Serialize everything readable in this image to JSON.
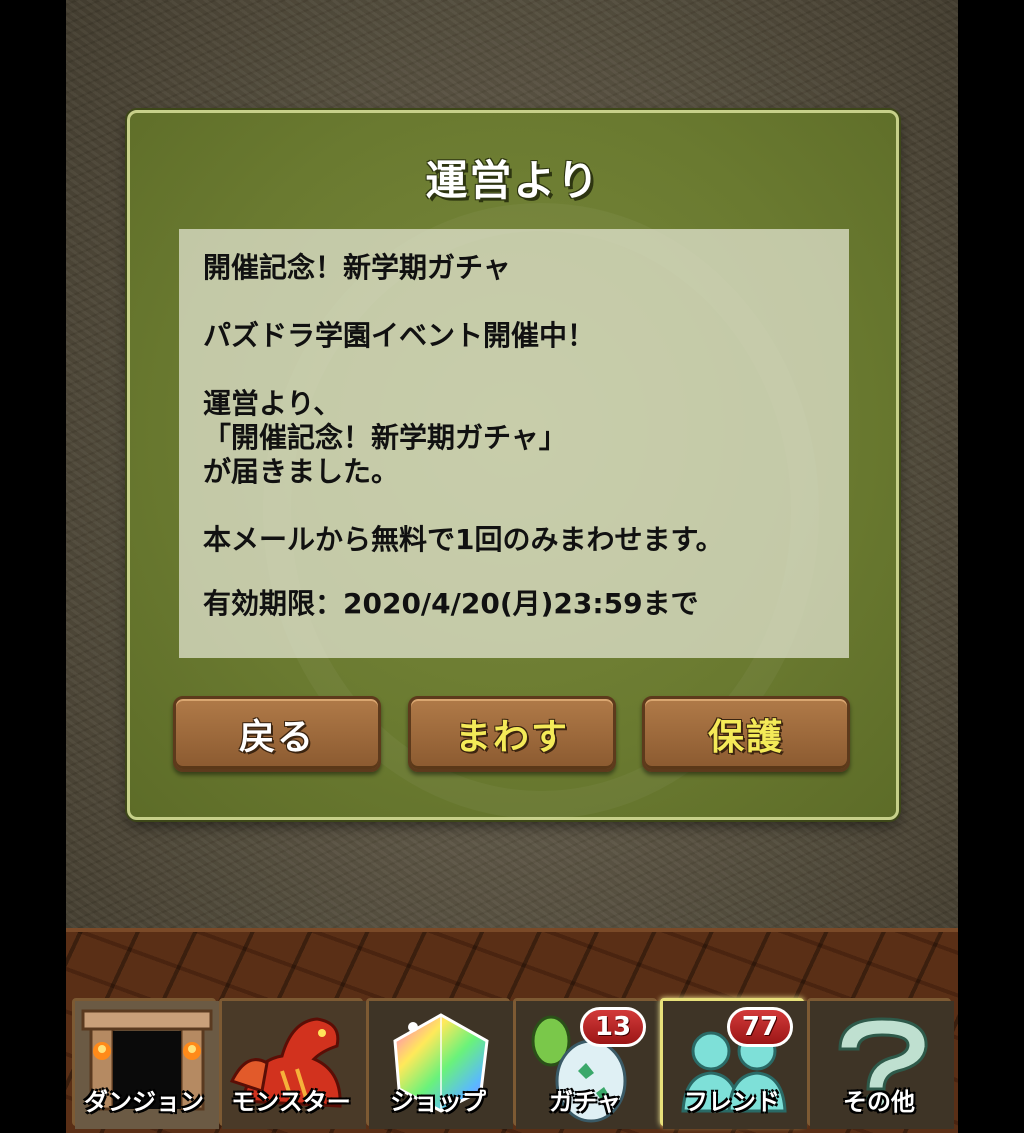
{
  "dialog": {
    "title": "運営より",
    "message": {
      "heading": "開催記念！新学期ガチャ",
      "event": "パズドラ学園イベント開催中！",
      "body_line1": "運営より、",
      "body_line2": "「開催記念！新学期ガチャ」",
      "body_line3": "が届きました。",
      "free_note": "本メールから無料で1回のみまわせます。",
      "expiry": "有効期限：2020/4/20(月)23:59まで"
    },
    "buttons": {
      "back": "戻る",
      "spin": "まわす",
      "protect": "保護"
    }
  },
  "nav": {
    "items": [
      {
        "label": "ダンジョン",
        "icon": "dungeon-gate-icon"
      },
      {
        "label": "モンスター",
        "icon": "red-dragon-icon"
      },
      {
        "label": "ショップ",
        "icon": "rainbow-gem-icon"
      },
      {
        "label": "ガチャ",
        "icon": "egg-icon",
        "badge": "13"
      },
      {
        "label": "フレンド",
        "icon": "friends-icon",
        "badge": "77",
        "active": true
      },
      {
        "label": "その他",
        "icon": "question-mark-icon"
      }
    ]
  },
  "colors": {
    "dialog_green": "#6a7a30",
    "button_brown": "#8b5a30",
    "button_yellow_text": "#f4ea58",
    "badge_red": "#c02828"
  }
}
